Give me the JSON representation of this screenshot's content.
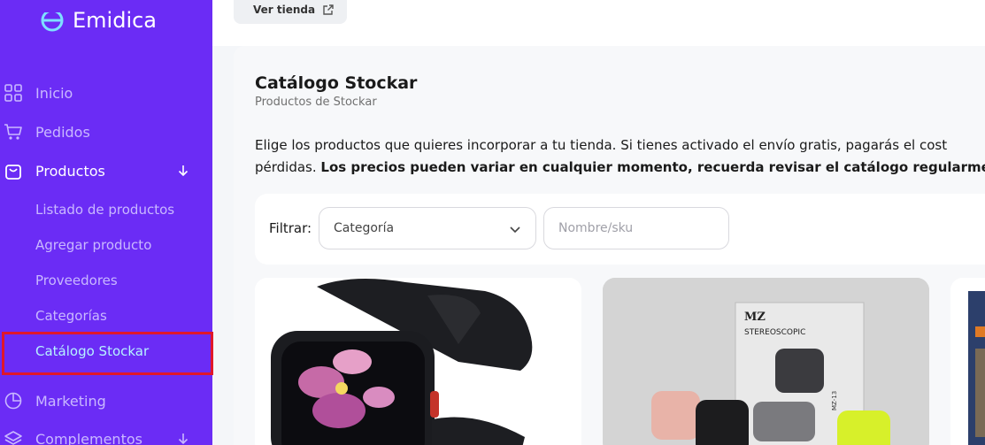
{
  "brand": {
    "name": "Emidica"
  },
  "topbar": {
    "ver_tienda": "Ver tienda"
  },
  "sidebar": {
    "items": [
      {
        "label": "Inicio",
        "icon": "grid-icon"
      },
      {
        "label": "Pedidos",
        "icon": "cart-icon"
      },
      {
        "label": "Productos",
        "icon": "bag-icon",
        "active": true,
        "expanded": true
      },
      {
        "label": "Marketing",
        "icon": "pie-chart-icon"
      },
      {
        "label": "Complementos",
        "icon": "layers-icon"
      }
    ],
    "sub_items": [
      {
        "label": "Listado de productos"
      },
      {
        "label": "Agregar producto"
      },
      {
        "label": "Proveedores"
      },
      {
        "label": "Categorías"
      },
      {
        "label": "Catálogo Stockar",
        "current": true
      }
    ]
  },
  "main": {
    "title": "Catálogo Stockar",
    "subtitle": "Productos de Stockar",
    "description_line1": "Elige los productos que quieres incorporar a tu tienda. Si tienes activado el envío gratis, pagarás el cost",
    "description_line2_plain": "pérdidas. ",
    "description_line2_bold": "Los precios pueden variar en cualquier momento, recuerda revisar el catálogo regularment",
    "filter": {
      "label": "Filtrar:",
      "category_value": "Categoría",
      "search_placeholder": "Nombre/sku"
    },
    "product_labels": {
      "p2_box_brand": "MZ",
      "p2_box_text": "STEREOSCOPIC",
      "p2_box_model": "MZ-13"
    }
  },
  "colors": {
    "sidebar_bg": "#6b2cf5",
    "highlight": "#e0172a",
    "current_sub": "#b6f2ff"
  }
}
